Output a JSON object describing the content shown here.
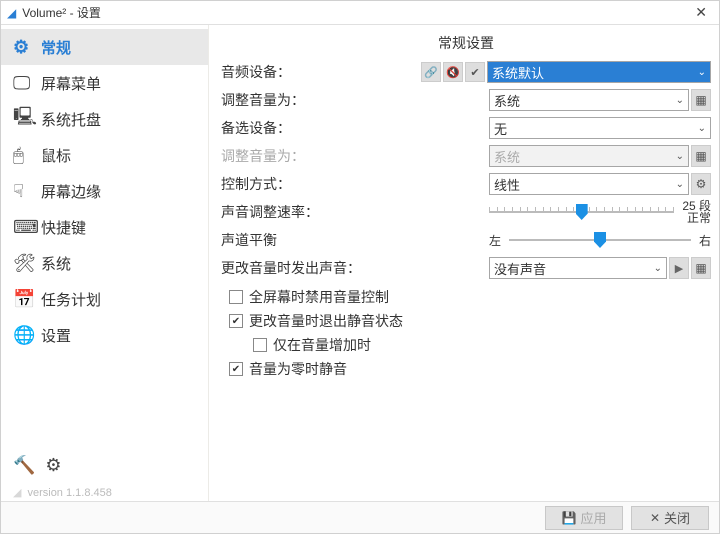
{
  "window": {
    "title": "Volume² - 设置",
    "close_tooltip": "Close"
  },
  "sidebar": {
    "items": [
      {
        "label": "常规"
      },
      {
        "label": "屏幕菜单"
      },
      {
        "label": "系统托盘"
      },
      {
        "label": "鼠标"
      },
      {
        "label": "屏幕边缘"
      },
      {
        "label": "快捷键"
      },
      {
        "label": "系统"
      },
      {
        "label": "任务计划"
      },
      {
        "label": "设置"
      }
    ],
    "version": "version 1.1.8.458"
  },
  "page": {
    "title": "常规设置",
    "labels": {
      "audio_device": "音频设备：",
      "adjust_volume_for": "调整音量为：",
      "alternate_device": "备选设备：",
      "adjust_volume_for2": "调整音量为：",
      "control_method": "控制方式：",
      "speed": "声音调整速率：",
      "balance": "声道平衡",
      "sound_on_change": "更改音量时发出声音："
    },
    "values": {
      "audio_device": "系统默认",
      "adjust_volume_for": "系统",
      "alternate_device": "无",
      "adjust_volume_for2": "系统",
      "control_method": "线性",
      "sound_on_change": "没有声音"
    },
    "slider_speed": {
      "value": 25,
      "max": 50,
      "suffix_label": "25 段",
      "caption": "正常"
    },
    "slider_balance": {
      "left_label": "左",
      "right_label": "右",
      "value_percent": 50
    },
    "checkboxes": {
      "disable_on_fullscreen": {
        "label": "全屏幕时禁用音量控制",
        "checked": false
      },
      "exit_mute_on_change": {
        "label": "更改音量时退出静音状态",
        "checked": true
      },
      "only_on_increase": {
        "label": "仅在音量增加时",
        "checked": false
      },
      "mute_on_zero": {
        "label": "音量为零时静音",
        "checked": true
      }
    }
  },
  "footer": {
    "apply": "应用",
    "close": "关闭"
  }
}
